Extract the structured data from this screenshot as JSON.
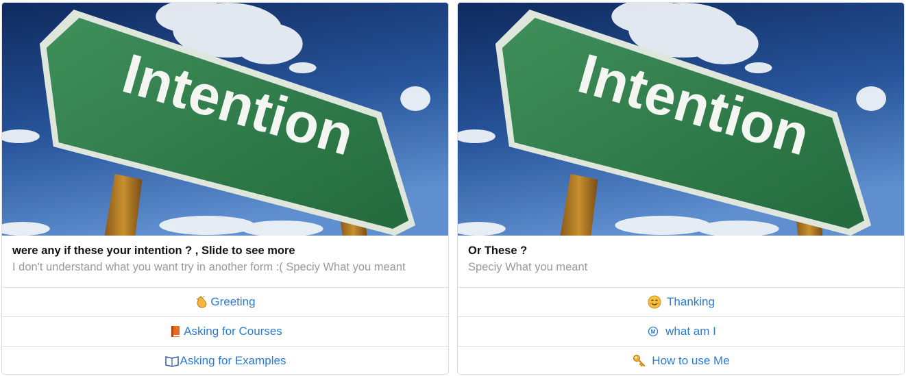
{
  "cards": [
    {
      "image": {
        "sign_text": "Intention"
      },
      "title": "were any if these your intention ? , Slide to see more",
      "subtitle": "I don't understand what you want try in another form :( Speciy What you meant",
      "buttons": [
        {
          "icon": "clapping-hands-icon",
          "label": "Greeting"
        },
        {
          "icon": "orange-book-icon",
          "label": "Asking for Courses"
        },
        {
          "icon": "open-book-icon",
          "label": "Asking for Examples"
        }
      ]
    },
    {
      "image": {
        "sign_text": "Intention"
      },
      "title": "Or These ?",
      "subtitle": "Speciy What you meant",
      "buttons": [
        {
          "icon": "smiling-face-icon",
          "label": "Thanking"
        },
        {
          "icon": "circled-m-icon",
          "label": "what am I"
        },
        {
          "icon": "key-icon",
          "label": "How to use Me"
        }
      ]
    }
  ],
  "colors": {
    "link": "#2a7ad2",
    "sign_green": "#2e7d4a",
    "sky": "#1f3f7a",
    "border": "#dcdcdc"
  }
}
